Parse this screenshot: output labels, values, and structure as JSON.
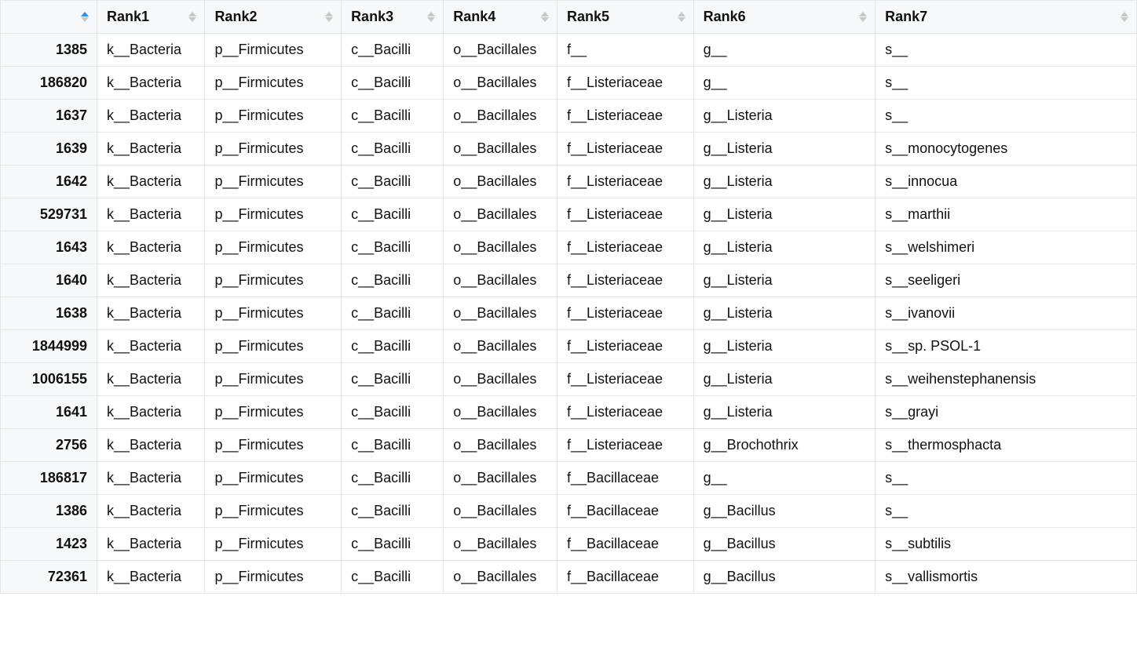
{
  "table": {
    "id_header": "",
    "headers": [
      "Rank1",
      "Rank2",
      "Rank3",
      "Rank4",
      "Rank5",
      "Rank6",
      "Rank7"
    ],
    "id_sorted_asc": true,
    "rows": [
      {
        "id": "1385",
        "cells": [
          "k__Bacteria",
          "p__Firmicutes",
          "c__Bacilli",
          "o__Bacillales",
          "f__",
          "g__",
          "s__"
        ]
      },
      {
        "id": "186820",
        "cells": [
          "k__Bacteria",
          "p__Firmicutes",
          "c__Bacilli",
          "o__Bacillales",
          "f__Listeriaceae",
          "g__",
          "s__"
        ]
      },
      {
        "id": "1637",
        "cells": [
          "k__Bacteria",
          "p__Firmicutes",
          "c__Bacilli",
          "o__Bacillales",
          "f__Listeriaceae",
          "g__Listeria",
          "s__"
        ]
      },
      {
        "id": "1639",
        "cells": [
          "k__Bacteria",
          "p__Firmicutes",
          "c__Bacilli",
          "o__Bacillales",
          "f__Listeriaceae",
          "g__Listeria",
          "s__monocytogenes"
        ]
      },
      {
        "id": "1642",
        "cells": [
          "k__Bacteria",
          "p__Firmicutes",
          "c__Bacilli",
          "o__Bacillales",
          "f__Listeriaceae",
          "g__Listeria",
          "s__innocua"
        ]
      },
      {
        "id": "529731",
        "cells": [
          "k__Bacteria",
          "p__Firmicutes",
          "c__Bacilli",
          "o__Bacillales",
          "f__Listeriaceae",
          "g__Listeria",
          "s__marthii"
        ]
      },
      {
        "id": "1643",
        "cells": [
          "k__Bacteria",
          "p__Firmicutes",
          "c__Bacilli",
          "o__Bacillales",
          "f__Listeriaceae",
          "g__Listeria",
          "s__welshimeri"
        ]
      },
      {
        "id": "1640",
        "cells": [
          "k__Bacteria",
          "p__Firmicutes",
          "c__Bacilli",
          "o__Bacillales",
          "f__Listeriaceae",
          "g__Listeria",
          "s__seeligeri"
        ]
      },
      {
        "id": "1638",
        "cells": [
          "k__Bacteria",
          "p__Firmicutes",
          "c__Bacilli",
          "o__Bacillales",
          "f__Listeriaceae",
          "g__Listeria",
          "s__ivanovii"
        ]
      },
      {
        "id": "1844999",
        "cells": [
          "k__Bacteria",
          "p__Firmicutes",
          "c__Bacilli",
          "o__Bacillales",
          "f__Listeriaceae",
          "g__Listeria",
          "s__sp. PSOL-1"
        ]
      },
      {
        "id": "1006155",
        "cells": [
          "k__Bacteria",
          "p__Firmicutes",
          "c__Bacilli",
          "o__Bacillales",
          "f__Listeriaceae",
          "g__Listeria",
          "s__weihenstephanensis"
        ]
      },
      {
        "id": "1641",
        "cells": [
          "k__Bacteria",
          "p__Firmicutes",
          "c__Bacilli",
          "o__Bacillales",
          "f__Listeriaceae",
          "g__Listeria",
          "s__grayi"
        ]
      },
      {
        "id": "2756",
        "cells": [
          "k__Bacteria",
          "p__Firmicutes",
          "c__Bacilli",
          "o__Bacillales",
          "f__Listeriaceae",
          "g__Brochothrix",
          "s__thermosphacta"
        ]
      },
      {
        "id": "186817",
        "cells": [
          "k__Bacteria",
          "p__Firmicutes",
          "c__Bacilli",
          "o__Bacillales",
          "f__Bacillaceae",
          "g__",
          "s__"
        ]
      },
      {
        "id": "1386",
        "cells": [
          "k__Bacteria",
          "p__Firmicutes",
          "c__Bacilli",
          "o__Bacillales",
          "f__Bacillaceae",
          "g__Bacillus",
          "s__"
        ]
      },
      {
        "id": "1423",
        "cells": [
          "k__Bacteria",
          "p__Firmicutes",
          "c__Bacilli",
          "o__Bacillales",
          "f__Bacillaceae",
          "g__Bacillus",
          "s__subtilis"
        ]
      },
      {
        "id": "72361",
        "cells": [
          "k__Bacteria",
          "p__Firmicutes",
          "c__Bacilli",
          "o__Bacillales",
          "f__Bacillaceae",
          "g__Bacillus",
          "s__vallismortis"
        ]
      }
    ]
  }
}
